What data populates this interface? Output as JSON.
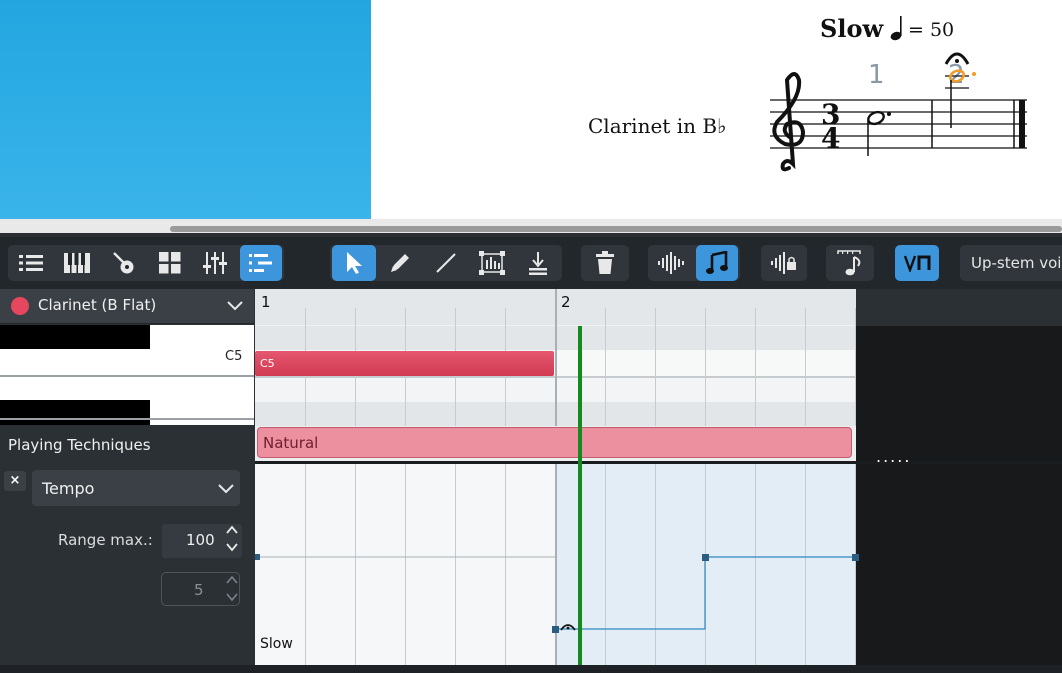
{
  "score": {
    "tempo_text": "Slow",
    "tempo_equals": "= 50",
    "instrument_name": "Clarinet in B♭",
    "measure_number_1": "1",
    "measure_number_2": "2",
    "time_sig_top": "3",
    "time_sig_bottom": "4"
  },
  "toolbar": {
    "left_icons": [
      "list-icon",
      "piano-icon",
      "guitar-icon",
      "grid-icon",
      "mixer-icon",
      "piano-roll-icon"
    ],
    "tools": [
      "select-arrow-icon",
      "pencil-icon",
      "line-icon",
      "chord-box-icon",
      "insert-icon"
    ],
    "delete_icon": "trash-icon",
    "view_icons": [
      "velocity-wave-icon",
      "note-icon"
    ],
    "extra_icons": [
      "locked-wave-icon",
      "duration-note-icon",
      "bowing-icon"
    ],
    "stem_voice": "Up-stem voice"
  },
  "instrument": {
    "name": "Clarinet (B Flat)",
    "color": "#e5475e"
  },
  "piano": {
    "key_label": "C5"
  },
  "playing_techniques": {
    "label": "Playing Techniques",
    "natural_label": "Natural"
  },
  "automation": {
    "close": "×",
    "param": "Tempo",
    "range_max_label": "Range max.:",
    "range_max_value": "100",
    "range_min_value": "5",
    "lane_text": "Slow",
    "dots": "....."
  },
  "roll": {
    "measure_1": "1",
    "measure_2": "2",
    "note_label": "C5"
  },
  "colors": {
    "accent": "#3d96dc",
    "playhead": "#138a1c",
    "note": "#d13a52",
    "natural": "#ec8f9e"
  }
}
